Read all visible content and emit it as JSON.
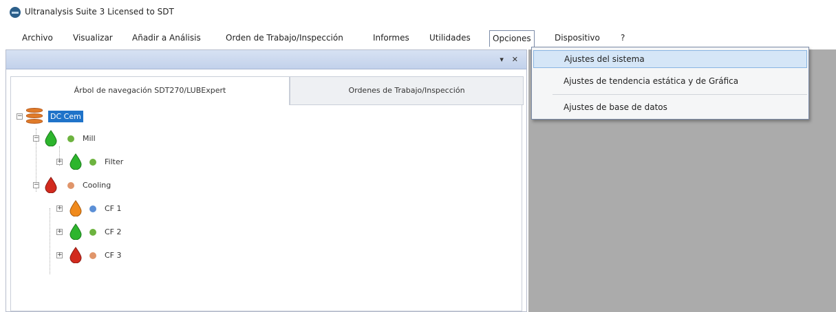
{
  "window": {
    "title": "Ultranalysis Suite 3 Licensed to SDT",
    "icon": "globe-icon"
  },
  "menubar": {
    "items": [
      "Archivo",
      "Visualizar",
      "Añadir a Análisis",
      "Orden de Trabajo/Inspección",
      "Informes",
      "Utilidades",
      "Opciones",
      "Dispositivo",
      "?"
    ],
    "open_item": "Opciones"
  },
  "pane": {
    "pin_icon": "▾",
    "close_icon": "✕",
    "tabs": [
      "Árbol de navegación SDT270/LUBExpert",
      "Ordenes de Trabajo/Inspección"
    ],
    "active_tab": 0
  },
  "tree": {
    "root": {
      "label": "DC Cem",
      "icon": "database-icon",
      "selected": true
    },
    "nodes": [
      {
        "label": "Mill",
        "drop_color": "#2db52d",
        "dot_color": "#6db33f"
      },
      {
        "label": "Filter",
        "drop_color": "#2db52d",
        "dot_color": "#6db33f"
      },
      {
        "label": "Cooling",
        "drop_color": "#d22a1e",
        "dot_color": "#e0956a"
      },
      {
        "label": "CF 1",
        "drop_color": "#f08a1c",
        "dot_color": "#5b8fd6"
      },
      {
        "label": "CF 2",
        "drop_color": "#2db52d",
        "dot_color": "#6db33f"
      },
      {
        "label": "CF 3",
        "drop_color": "#d22a1e",
        "dot_color": "#e0956a"
      }
    ]
  },
  "opciones_menu": {
    "items": [
      "Ajustes del sistema",
      "Ajustes de tendencia estática y de Gráfica",
      "Ajustes de base de datos"
    ],
    "highlighted": 0
  },
  "colors": {
    "selection": "#1f73c9",
    "workspace": "#ababab",
    "menu_highlight": "#d5e6f7"
  }
}
